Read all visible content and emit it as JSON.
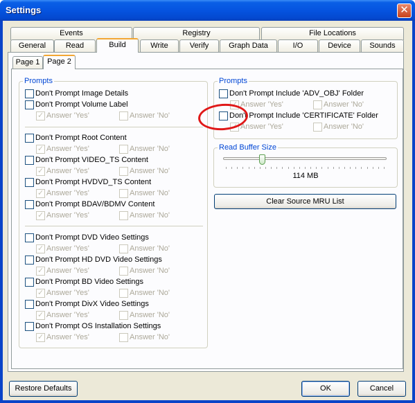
{
  "window": {
    "title": "Settings",
    "close_icon": "close-icon"
  },
  "tabs_row1": [
    "Events",
    "Registry",
    "File Locations"
  ],
  "tabs_row2": [
    "General",
    "Read",
    "Build",
    "Write",
    "Verify",
    "Graph Data",
    "I/O",
    "Device",
    "Sounds"
  ],
  "selected_tab": "Build",
  "subtabs": [
    "Page 1",
    "Page 2"
  ],
  "selected_subtab": "Page 2",
  "left_group": {
    "title": "Prompts",
    "items": [
      {
        "label": "Don't Prompt Image Details"
      },
      {
        "label": "Don't Prompt Volume Label",
        "yes": "Answer 'Yes'",
        "no": "Answer 'No'"
      },
      {
        "label": "Don't Prompt Root Content",
        "yes": "Answer 'Yes'",
        "no": "Answer 'No'"
      },
      {
        "label": "Don't Prompt VIDEO_TS Content",
        "yes": "Answer 'Yes'",
        "no": "Answer 'No'"
      },
      {
        "label": "Don't Prompt HVDVD_TS Content",
        "yes": "Answer 'Yes'",
        "no": "Answer 'No'"
      },
      {
        "label": "Don't Prompt BDAV/BDMV Content",
        "yes": "Answer 'Yes'",
        "no": "Answer 'No'"
      },
      {
        "label": "Don't Prompt DVD Video Settings",
        "yes": "Answer 'Yes'",
        "no": "Answer 'No'"
      },
      {
        "label": "Don't Prompt HD DVD Video Settings",
        "yes": "Answer 'Yes'",
        "no": "Answer 'No'"
      },
      {
        "label": "Don't Prompt BD Video Settings",
        "yes": "Answer 'Yes'",
        "no": "Answer 'No'"
      },
      {
        "label": "Don't Prompt DivX Video Settings",
        "yes": "Answer 'Yes'",
        "no": "Answer 'No'"
      },
      {
        "label": "Don't Prompt OS Installation Settings",
        "yes": "Answer 'Yes'",
        "no": "Answer 'No'"
      }
    ]
  },
  "right_group": {
    "title": "Prompts",
    "items": [
      {
        "label": "Don't Prompt Include 'ADV_OBJ' Folder",
        "yes": "Answer 'Yes'",
        "no": "Answer 'No'"
      },
      {
        "label": "Don't Prompt Include 'CERTIFICATE' Folder",
        "yes": "Answer 'Yes'",
        "no": "Answer 'No'"
      }
    ]
  },
  "read_buffer": {
    "title": "Read Buffer Size",
    "value_label": "114 MB",
    "slider_fraction": 0.23
  },
  "buttons": {
    "clear_mru": "Clear Source MRU List",
    "restore": "Restore Defaults",
    "ok": "OK",
    "cancel": "Cancel"
  }
}
